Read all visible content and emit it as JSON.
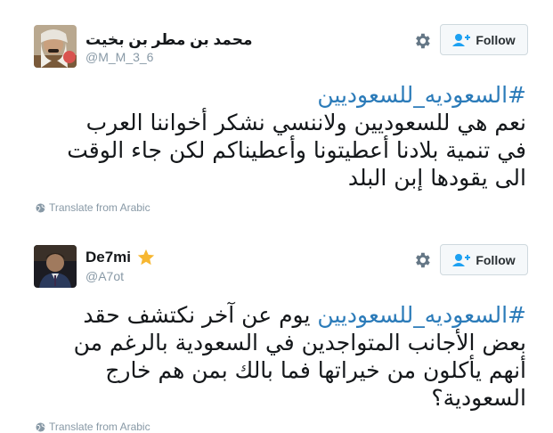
{
  "tweets": [
    {
      "display_name": "محمد بن مطر بن بخيت",
      "handle": "@M_M_3_6",
      "verified": false,
      "hashtag": "#السعوديه_للسعوديين",
      "text_lines": [
        "نعم هي للسعوديين ولاننسي نشكر أخواننا العرب",
        "في تنمية بلادنا أعطيتونا وأعطيناكم لكن جاء الوقت",
        "الى يقودها إبن البلد"
      ],
      "follow_label": "Follow",
      "translate_label": "Translate from Arabic"
    },
    {
      "display_name": "De7mi",
      "handle": "@A7ot",
      "verified": true,
      "hashtag": "#السعوديه_للسعوديين",
      "text_lines": [
        " يوم عن آخر نكتشف حقد",
        "بعض الأجانب المتواجدين في السعودية بالرغم من",
        "أنهم يأكلون من خيراتها فما بالك بمن هم خارج",
        "السعودية؟"
      ],
      "follow_label": "Follow",
      "translate_label": "Translate from Arabic"
    }
  ],
  "icons": {
    "settings": "gear-icon",
    "follow": "follow-user-plus-icon",
    "translate": "globe-icon",
    "badge": "star-icon"
  },
  "colors": {
    "hashtag": "#2b7bb9",
    "handle": "#8899a6",
    "star": "#f7b731",
    "button_bg": "#f5f8fa",
    "follow_icon": "#1da1f2"
  }
}
